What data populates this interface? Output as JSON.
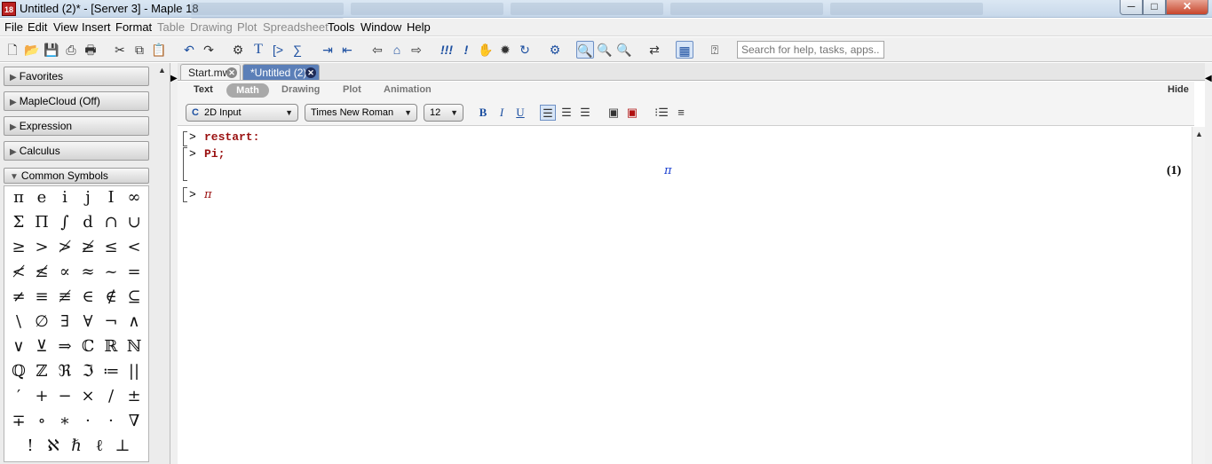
{
  "window": {
    "title": "Untitled (2)* - [Server 3] - Maple 18",
    "app_icon_text": "18",
    "buttons": {
      "minimize": "─",
      "maximize": "□",
      "close": "✕"
    }
  },
  "menu": [
    "File",
    "Edit",
    "View",
    "Insert",
    "Format",
    "Table",
    "Drawing",
    "Plot",
    "Spreadsheet",
    "Tools",
    "Window",
    "Help"
  ],
  "toolbar": {
    "search_placeholder": "Search for help, tasks, apps..."
  },
  "palette": {
    "sections": [
      {
        "label": "Favorites",
        "expanded": false
      },
      {
        "label": "MapleCloud (Off)",
        "expanded": false
      },
      {
        "label": "Expression",
        "expanded": false
      },
      {
        "label": "Calculus",
        "expanded": false
      },
      {
        "label": "Common Symbols",
        "expanded": true
      }
    ],
    "symbols": [
      "π",
      "e",
      "i",
      "j",
      "I",
      "∞",
      "Σ",
      "Π",
      "∫",
      "d",
      "∩",
      "∪",
      "≥",
      ">",
      "≯",
      "≱",
      "≤",
      "<",
      "≮",
      "≰",
      "∝",
      "≈",
      "~",
      "=",
      "≠",
      "≡",
      "≢",
      "∈",
      "∉",
      "⊆",
      "\\",
      "∅",
      "∃",
      "∀",
      "¬",
      "∧",
      "∨",
      "⊻",
      "⇒",
      "ℂ",
      "ℝ",
      "ℕ",
      "ℚ",
      "ℤ",
      "ℜ",
      "ℑ",
      "≔",
      "||",
      "′",
      "+",
      "−",
      "×",
      "/",
      "±",
      "∓",
      "∘",
      "∗",
      "·",
      "·",
      "∇",
      "!",
      "ℵ",
      "ℏ",
      "ℓ",
      "⊥"
    ]
  },
  "tabs": [
    {
      "label": "Start.mw",
      "active": false
    },
    {
      "label": "*Untitled (2)",
      "active": true
    }
  ],
  "modes": {
    "text": "Text",
    "math": "Math",
    "drawing": "Drawing",
    "plot": "Plot",
    "animation": "Animation",
    "hide": "Hide"
  },
  "format": {
    "input_mode": "2D Input",
    "input_mode_icon": "C",
    "font": "Times New Roman",
    "size": "12",
    "bold": "B",
    "italic": "I",
    "underline": "U"
  },
  "worksheet": {
    "prompt": ">",
    "lines": [
      {
        "input": "restart:"
      },
      {
        "input": "Pi;",
        "output": "π",
        "label": "(1)"
      },
      {
        "input": "π"
      }
    ]
  },
  "colors": {
    "input_text": "#9a1010",
    "output_text": "#1a3fd0",
    "active_tab": "#5b7fb8"
  }
}
